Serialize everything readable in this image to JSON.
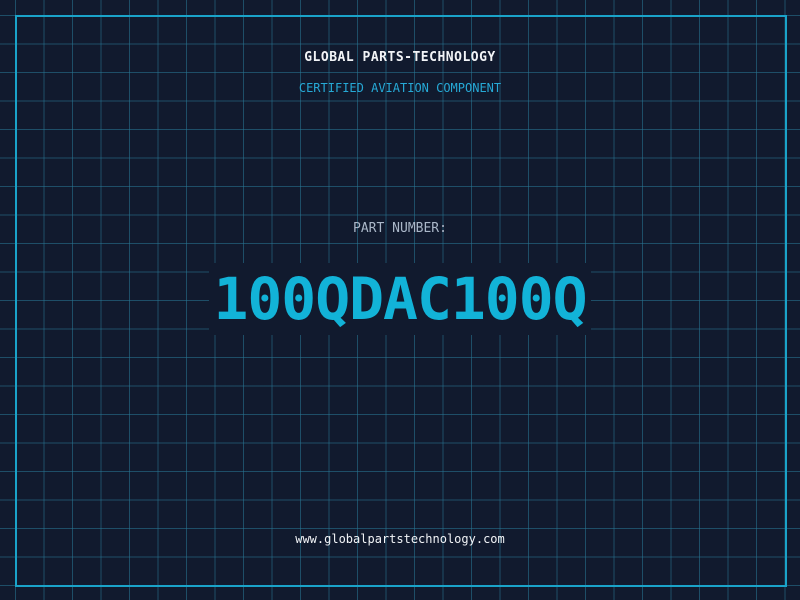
{
  "brand": {
    "title": "GLOBAL PARTS-TECHNOLOGY",
    "subtitle": "CERTIFIED AVIATION COMPONENT"
  },
  "part": {
    "label": "PART NUMBER:",
    "number": "100QDAC100Q"
  },
  "footer": {
    "website": "www.globalpartstechnology.com"
  },
  "colors": {
    "background": "#111a2e",
    "grid": "#28789a",
    "accent": "#12b3d8",
    "text": "#f2f4f7",
    "muted": "#aab7c8"
  }
}
